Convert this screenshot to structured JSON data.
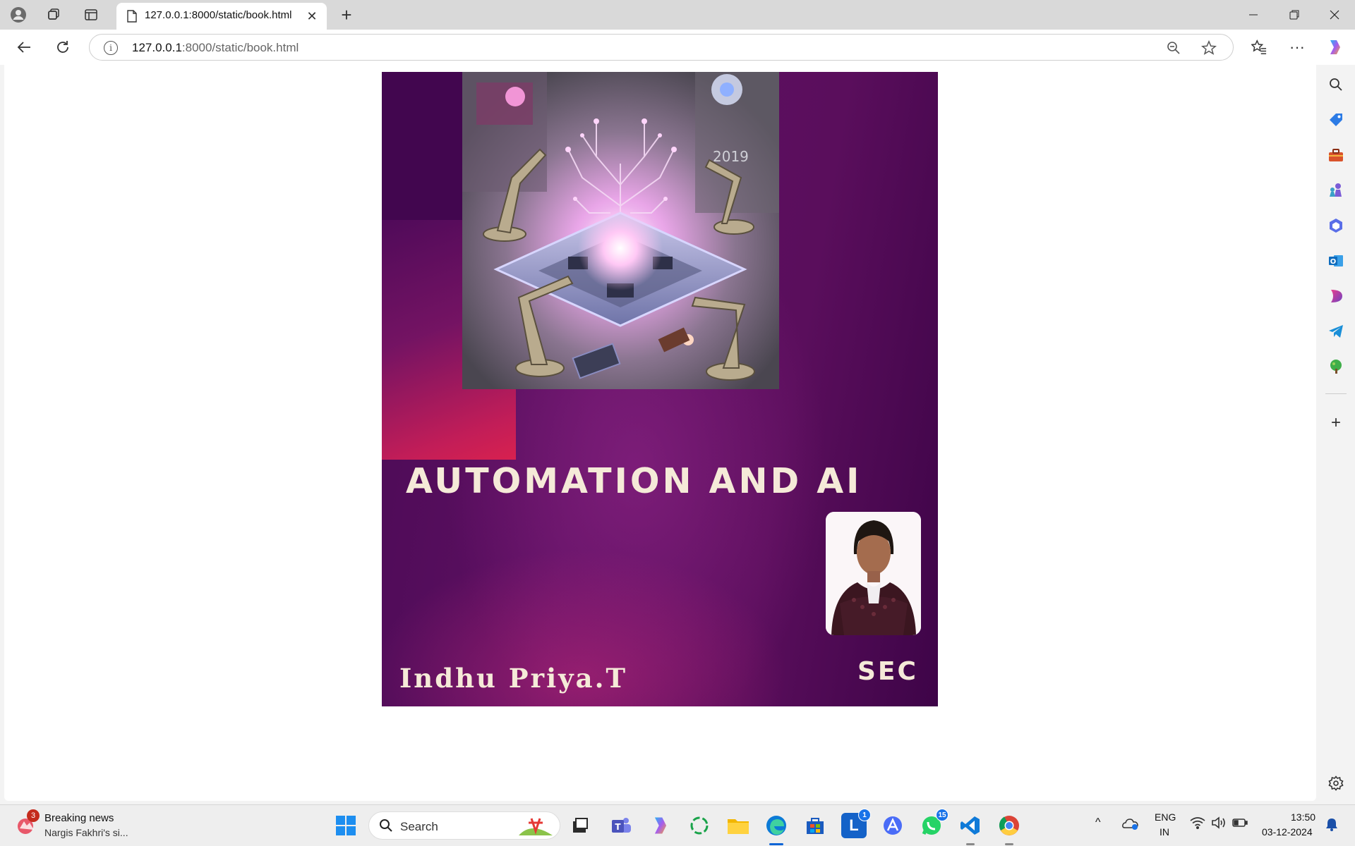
{
  "browser": {
    "tab_title": "127.0.0.1:8000/static/book.html",
    "url_host": "127.0.0.1",
    "url_rest": ":8000/static/book.html"
  },
  "book": {
    "title": "AUTOMATION AND AI",
    "author": "Indhu Priya.T",
    "institution": "SEC",
    "image_year": "2019"
  },
  "colors": {
    "cover_base": "#5e1062",
    "cover_accent": "#d8214f",
    "title_text": "#f5ead8"
  },
  "edge_sidebar": {
    "icons": [
      "search-icon",
      "tag-icon",
      "toolbox-icon",
      "chess-icon",
      "copilot-icon",
      "outlook-icon",
      "designer-icon",
      "telegram-icon",
      "tree-icon",
      "add-icon",
      "settings-icon"
    ]
  },
  "taskbar": {
    "news_title": "Breaking news",
    "news_subtitle": "Nargis Fakhri's si...",
    "news_badge": "3",
    "search_label": "Search",
    "apps": [
      {
        "name": "start",
        "label": ""
      },
      {
        "name": "task-view",
        "label": ""
      },
      {
        "name": "teams",
        "label": "T"
      },
      {
        "name": "copilot",
        "label": ""
      },
      {
        "name": "chatgpt",
        "label": ""
      },
      {
        "name": "file-explorer",
        "label": ""
      },
      {
        "name": "edge",
        "label": ""
      },
      {
        "name": "store",
        "label": ""
      },
      {
        "name": "l-app",
        "label": "L",
        "badge": "1"
      },
      {
        "name": "a-app",
        "label": "A"
      },
      {
        "name": "whatsapp",
        "label": "",
        "badge": "15"
      },
      {
        "name": "vscode",
        "label": ""
      },
      {
        "name": "chrome",
        "label": ""
      }
    ],
    "lang_line1": "ENG",
    "lang_line2": "IN",
    "time": "13:50",
    "date": "03-12-2024"
  }
}
